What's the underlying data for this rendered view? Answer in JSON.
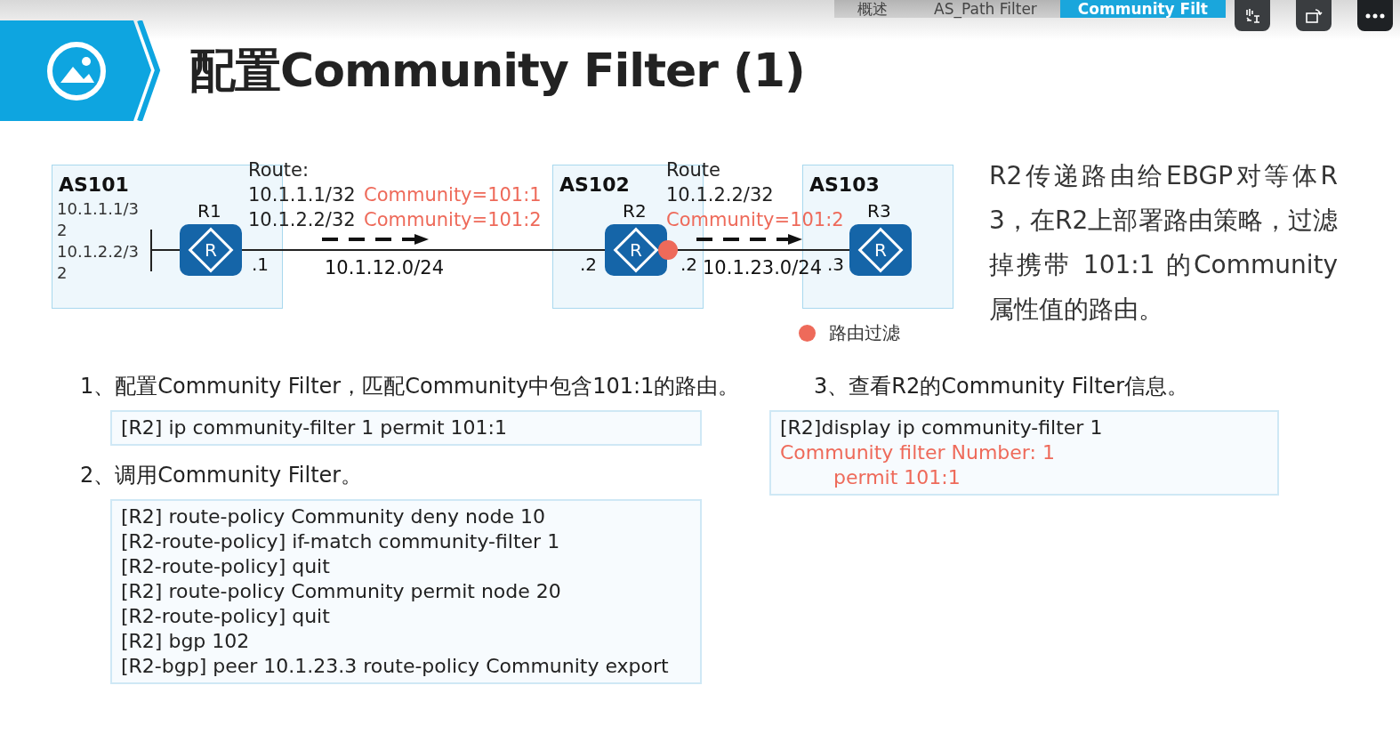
{
  "breadcrumb": [
    {
      "label": "概述",
      "selected": false
    },
    {
      "label": "AS_Path Filter",
      "selected": false
    },
    {
      "label": "Community Filt",
      "selected": true
    }
  ],
  "title": "配置Community Filter (1)",
  "diagram": {
    "as_areas": [
      {
        "label": "AS101",
        "prefixes": [
          "10.1.1.1/32",
          "10.1.2.2/32"
        ]
      },
      {
        "label": "AS102"
      },
      {
        "label": "AS103"
      }
    ],
    "routers": [
      {
        "label": "R1",
        "glyph": "R"
      },
      {
        "label": "R2",
        "glyph": "R"
      },
      {
        "label": "R3",
        "glyph": "R"
      }
    ],
    "links": [
      {
        "left_ip": ".1",
        "network": "10.1.12.0/24",
        "right_ip": ".2"
      },
      {
        "left_ip": ".2",
        "network": "10.1.23.0/24",
        "right_ip": ".3"
      }
    ],
    "route_updates": [
      {
        "heading": "Route:",
        "routes": [
          {
            "prefix": "10.1.1.1/32",
            "community": "Community=101:1"
          },
          {
            "prefix": "10.1.2.2/32",
            "community": "Community=101:2"
          }
        ]
      },
      {
        "heading": "Route",
        "routes": [
          {
            "prefix": "10.1.2.2/32",
            "community": "Community=101:2"
          }
        ]
      }
    ],
    "legend": {
      "label": "路由过滤",
      "color": "#ee6a5a"
    }
  },
  "description": "R2传递路由给EBGP对等体R3，在R2上部署路由策略，过滤掉携带 101:1 的Community属性值的路由。",
  "steps": [
    {
      "heading": "1、配置Community Filter，匹配Community中包含101:1的路由。",
      "lines": [
        {
          "kind": "command",
          "text": "[R2] ip community-filter 1 permit 101:1"
        }
      ]
    },
    {
      "heading": "2、调用Community Filter。",
      "lines": [
        {
          "kind": "command",
          "text": "[R2] route-policy Community deny node 10"
        },
        {
          "kind": "command",
          "text": "[R2-route-policy] if-match community-filter 1"
        },
        {
          "kind": "command",
          "text": "[R2-route-policy] quit"
        },
        {
          "kind": "command",
          "text": "[R2] route-policy Community permit node 20"
        },
        {
          "kind": "command",
          "text": "[R2-route-policy] quit"
        },
        {
          "kind": "command",
          "text": "[R2] bgp 102"
        },
        {
          "kind": "command",
          "text": "[R2-bgp] peer 10.1.23.3 route-policy Community export"
        }
      ]
    },
    {
      "heading": "3、查看R2的Community Filter信息。",
      "lines": [
        {
          "kind": "command",
          "text": "[R2]display ip community-filter 1"
        },
        {
          "kind": "output",
          "text": "Community filter Number: 1",
          "children": [
            {
              "kind": "output",
              "text": "permit 101:1"
            }
          ]
        }
      ]
    }
  ]
}
